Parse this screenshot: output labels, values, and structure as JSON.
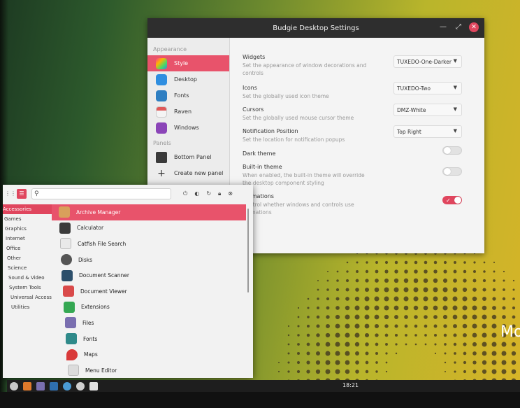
{
  "desktop": {
    "brand_text": "Mo"
  },
  "settings": {
    "title": "Budgie Desktop Settings",
    "sidebar": {
      "appearance_header": "Appearance",
      "panels_header": "Panels",
      "items": [
        {
          "label": "Style",
          "icon": "style-icon",
          "color": "#e94f8b"
        },
        {
          "label": "Desktop",
          "icon": "desktop-icon",
          "color": "#2f8ee0"
        },
        {
          "label": "Fonts",
          "icon": "fonts-icon",
          "color": "#2f7fc2"
        },
        {
          "label": "Raven",
          "icon": "raven-icon",
          "color": "#e05a5a"
        },
        {
          "label": "Windows",
          "icon": "windows-icon",
          "color": "#8b45b8"
        }
      ],
      "panel_items": [
        {
          "label": "Bottom Panel",
          "icon": "panel-icon"
        },
        {
          "label": "Create new panel",
          "icon": "plus-icon"
        }
      ]
    },
    "rows": [
      {
        "title": "Widgets",
        "desc": "Set the appearance of window decorations and controls",
        "value": "TUXEDO-One-Darker"
      },
      {
        "title": "Icons",
        "desc": "Set the globally used icon theme",
        "value": "TUXEDO-Two"
      },
      {
        "title": "Cursors",
        "desc": "Set the globally used mouse cursor theme",
        "value": "DMZ-White"
      },
      {
        "title": "Notification Position",
        "desc": "Set the location for notification popups",
        "value": "Top Right"
      },
      {
        "title": "Dark theme",
        "desc": "",
        "toggle": false
      },
      {
        "title": "Built-in theme",
        "desc": "When enabled, the built-in theme will override the desktop component styling",
        "toggle": false
      },
      {
        "title": "Animations",
        "desc": "Control whether windows and controls use animations",
        "toggle": true
      }
    ]
  },
  "menu": {
    "search_placeholder": "",
    "categories": [
      "Accessories",
      "Games",
      "Graphics",
      "Internet",
      "Office",
      "Other",
      "Science",
      "Sound & Video",
      "System Tools",
      "Universal Access",
      "Utilities"
    ],
    "apps": [
      {
        "label": "Archive Manager",
        "icon": "archive-icon",
        "color": "#d9a05b"
      },
      {
        "label": "Calculator",
        "icon": "calculator-icon",
        "color": "#3a3a3a"
      },
      {
        "label": "Catfish File Search",
        "icon": "catfish-icon",
        "color": "#e9e9e9"
      },
      {
        "label": "Disks",
        "icon": "disks-icon",
        "color": "#555555"
      },
      {
        "label": "Document Scanner",
        "icon": "scanner-icon",
        "color": "#2c4f6b"
      },
      {
        "label": "Document Viewer",
        "icon": "document-viewer-icon",
        "color": "#d94a4a"
      },
      {
        "label": "Extensions",
        "icon": "extensions-icon",
        "color": "#35a853"
      },
      {
        "label": "Files",
        "icon": "files-icon",
        "color": "#7a6fb0"
      },
      {
        "label": "Fonts",
        "icon": "fonts-icon",
        "color": "#2f8a8a"
      },
      {
        "label": "Maps",
        "icon": "maps-icon",
        "color": "#d93a3a"
      },
      {
        "label": "Menu Editor",
        "icon": "menu-editor-icon",
        "color": "#dcdcdc"
      }
    ]
  },
  "taskbar": {
    "clock": "18:21",
    "apps": [
      {
        "icon": "menu-icon",
        "color": "#c8c8c8"
      },
      {
        "icon": "firefox-icon",
        "color": "#e0792b"
      },
      {
        "icon": "files-icon",
        "color": "#7a6fb0"
      },
      {
        "icon": "terminal-icon",
        "color": "#2f6fb0"
      },
      {
        "icon": "browser-icon",
        "color": "#4a9ad4"
      },
      {
        "icon": "settings-icon",
        "color": "#d0d0d0"
      },
      {
        "icon": "screenshot-icon",
        "color": "#e0e0e0"
      }
    ]
  },
  "colors": {
    "accent": "#e0465e",
    "titlebar": "#2e2e2e"
  }
}
